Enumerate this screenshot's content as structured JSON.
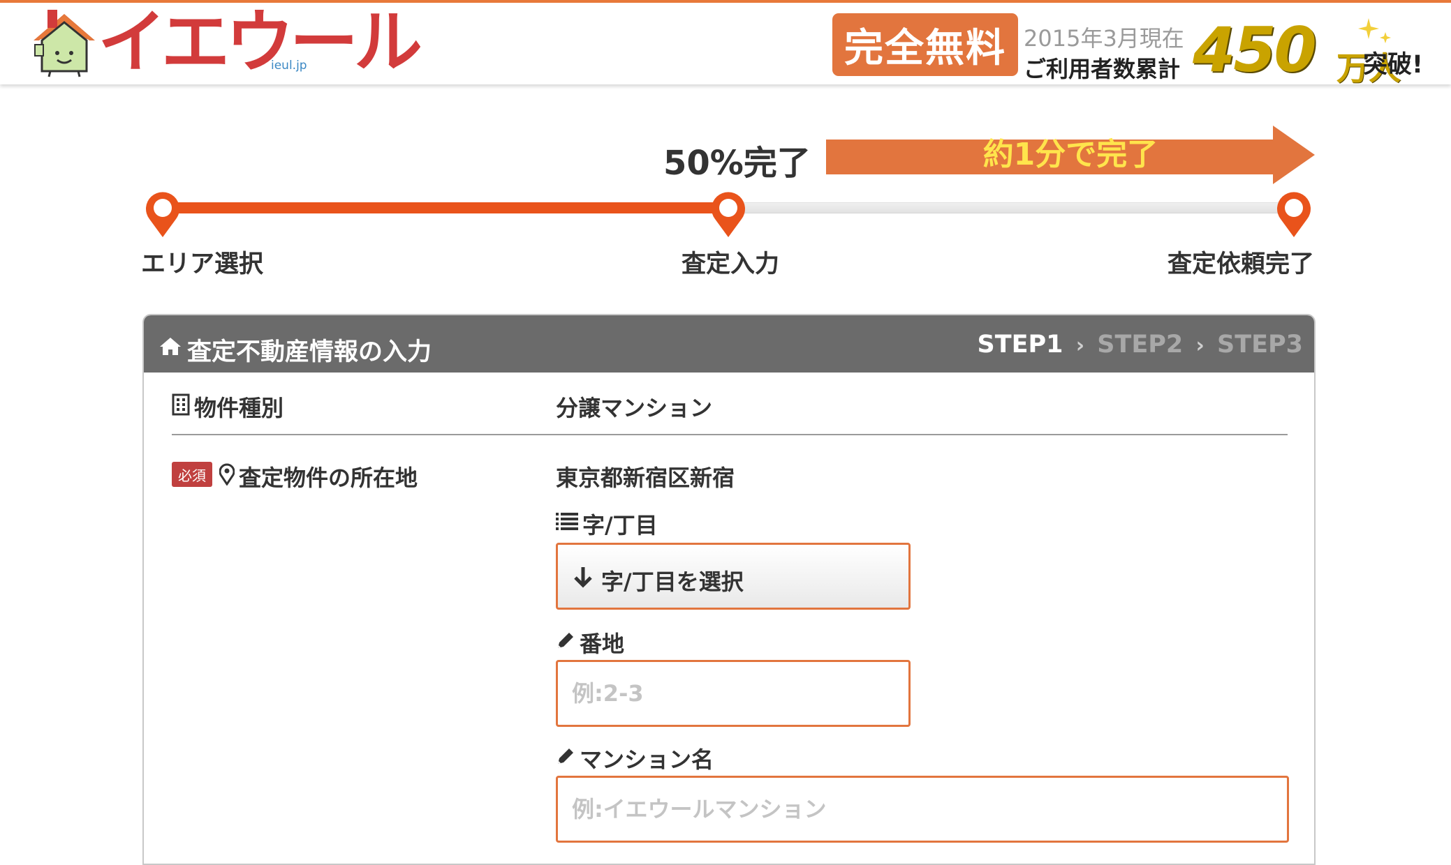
{
  "header": {
    "logo_text": "イエウール",
    "logo_sub": "ieul.jp",
    "free_badge": "完全無料",
    "promo_date": "2015年3月現在",
    "promo_users": "ご利用者数累計",
    "promo_number": "450",
    "promo_unit": "万人",
    "promo_tail": "突破!"
  },
  "progress": {
    "percent_text": "50%完了",
    "arrow_text": "約1分で完了",
    "fraction_complete": 0.5,
    "steps": [
      {
        "label": "エリア選択"
      },
      {
        "label": "査定入力"
      },
      {
        "label": "査定依頼完了"
      }
    ]
  },
  "panel": {
    "title": "査定不動産情報の入力",
    "breadcrumb": {
      "step1": "STEP1",
      "step2": "STEP2",
      "step3": "STEP3",
      "separator": "›"
    },
    "property_type": {
      "label": "物件種別",
      "value": "分譲マンション"
    },
    "location": {
      "required_badge": "必須",
      "label": "査定物件の所在地",
      "value": "東京都新宿区新宿"
    },
    "chome": {
      "label": "字/丁目",
      "select_label": "字/丁目を選択"
    },
    "banchi": {
      "label": "番地",
      "placeholder": "例:2-3",
      "value": ""
    },
    "mansion_name": {
      "label": "マンション名",
      "placeholder": "例:イエウールマンション",
      "value": ""
    }
  },
  "colors": {
    "brand_red": "#d23b3b",
    "accent_orange": "#e2753e",
    "progress_fill": "#e9531b",
    "panel_header": "#6b6b6b",
    "required_badge": "#c0403f",
    "promo_gold": "#c9a300"
  },
  "icons": {
    "logo": "house-mascot-icon",
    "panel_title": "home-icon",
    "property_type": "building-icon",
    "location": "map-marker-icon",
    "chome": "list-icon",
    "select": "arrow-down-icon",
    "banchi": "pencil-icon",
    "mansion_name": "pencil-icon"
  }
}
